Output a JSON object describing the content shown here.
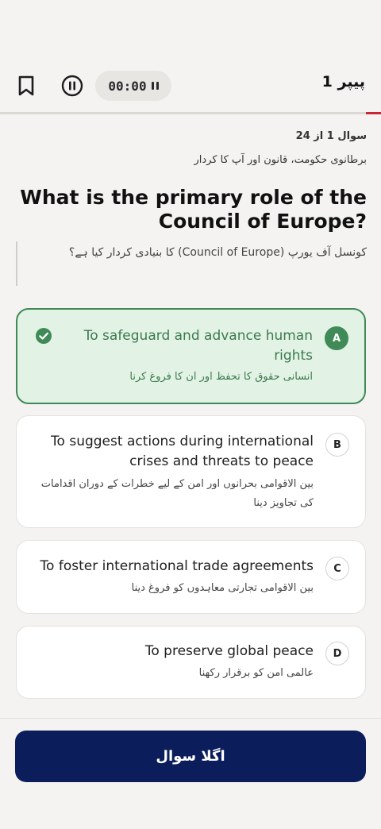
{
  "header": {
    "paper_title": "پیپر 1",
    "timer": "00:00",
    "progress_fraction": 0.04
  },
  "question": {
    "counter": "سوال 1 از 24",
    "topic": "برطانوی حکومت، قانون اور آپ کا کردار",
    "text_en": "What is the primary role of the Council of Europe?",
    "text_ur": "کونسل آف یورپ (Council of Europe) کا بنیادی کردار کیا ہے؟"
  },
  "options": [
    {
      "letter": "A",
      "text_en": "To safeguard and advance human rights",
      "text_ur": "انسانی حقوق کا تحفظ اور ان کا فروغ کرنا",
      "selected": true
    },
    {
      "letter": "B",
      "text_en": "To suggest actions during international crises and threats to peace",
      "text_ur": "بین الاقوامی بحرانوں اور امن کے لیے خطرات کے دوران اقدامات کی تجاویز دینا",
      "selected": false
    },
    {
      "letter": "C",
      "text_en": "To foster international trade agreements",
      "text_ur": "بین الاقوامی تجارتی معاہدوں کو فروغ دینا",
      "selected": false
    },
    {
      "letter": "D",
      "text_en": "To preserve global peace",
      "text_ur": "عالمی امن کو برقرار رکھنا",
      "selected": false
    }
  ],
  "footer": {
    "next_label": "اگلا سوال"
  },
  "colors": {
    "accent_red": "#c8253a",
    "correct_green": "#3f8a56",
    "primary_navy": "#0c1d5c"
  },
  "icons": {
    "bookmark": "bookmark-icon",
    "pause": "pause-circle-icon",
    "check": "check-circle-icon"
  }
}
